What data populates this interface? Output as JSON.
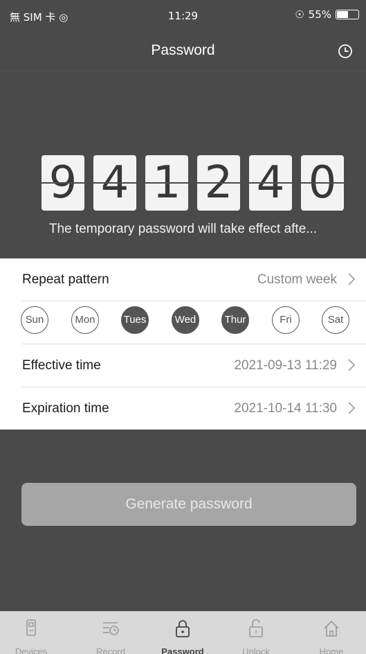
{
  "status_bar": {
    "carrier": "無 SIM 卡",
    "time": "11:29",
    "battery_text": "55%",
    "battery_level": 0.55
  },
  "nav": {
    "title": "Password",
    "history_icon": "clock-icon"
  },
  "password": {
    "digits": [
      "9",
      "4",
      "1",
      "2",
      "4",
      "0"
    ],
    "notice": "The temporary password will take effect afte..."
  },
  "settings": {
    "repeat": {
      "label": "Repeat pattern",
      "value": "Custom week"
    },
    "days": [
      {
        "label": "Sun",
        "selected": false
      },
      {
        "label": "Mon",
        "selected": false
      },
      {
        "label": "Tues",
        "selected": true
      },
      {
        "label": "Wed",
        "selected": true
      },
      {
        "label": "Thur",
        "selected": true
      },
      {
        "label": "Fri",
        "selected": false
      },
      {
        "label": "Sat",
        "selected": false
      }
    ],
    "effective": {
      "label": "Effective time",
      "value": "2021-09-13 11:29"
    },
    "expiration": {
      "label": "Expiration time",
      "value": "2021-10-14 11:30"
    }
  },
  "generate_button": "Generate password",
  "tabs": [
    {
      "label": "Devices",
      "icon": "lock-device-icon",
      "active": false
    },
    {
      "label": "Record",
      "icon": "record-list-icon",
      "active": false
    },
    {
      "label": "Password",
      "icon": "padlock-icon",
      "active": true
    },
    {
      "label": "Unlock",
      "icon": "unlock-icon",
      "active": false
    },
    {
      "label": "Home",
      "icon": "home-icon",
      "active": false
    }
  ],
  "colors": {
    "background": "#4a4a4a",
    "panel": "#ffffff",
    "button": "#a6a6a6",
    "selected_day": "#555555"
  }
}
